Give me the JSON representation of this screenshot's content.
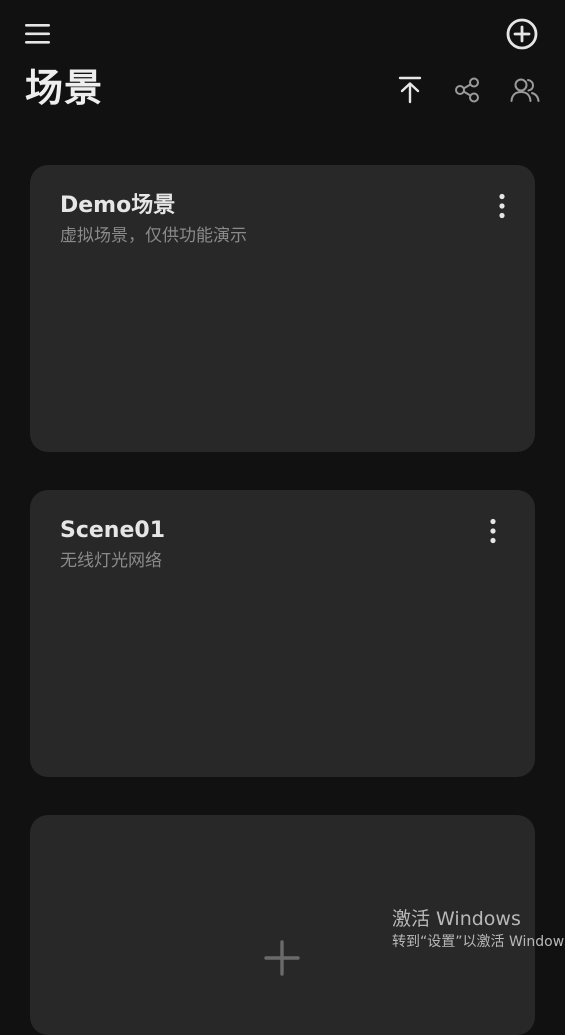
{
  "header": {
    "title": "场景",
    "icons": {
      "menu": "hamburger-menu-icon",
      "add": "add-circle-icon",
      "upload": "upload-to-top-icon",
      "share": "share-icon",
      "users": "users-icon"
    }
  },
  "scenes": [
    {
      "name": "Demo场景",
      "description": "虚拟场景，仅供功能演示"
    },
    {
      "name": "Scene01",
      "description": "无线灯光网络"
    }
  ],
  "add_card": {
    "icon": "plus-icon"
  },
  "watermark": {
    "title": "激活 Windows",
    "subtitle": "转到“设置”以激活 Windows。"
  },
  "colors": {
    "background": "#111111",
    "card": "#282828",
    "text": "#e6e6e6",
    "subtext": "#8a8a8a",
    "icon_muted": "#9a9a9a",
    "plus": "#6a6a6a"
  }
}
